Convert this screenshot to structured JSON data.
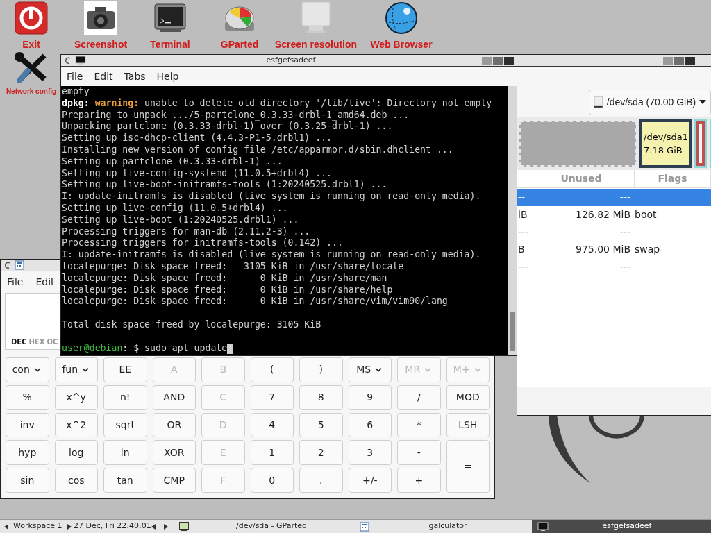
{
  "desktop_icons": [
    {
      "label": "Exit",
      "kind": "exit"
    },
    {
      "label": "Screenshot",
      "kind": "camera"
    },
    {
      "label": "Terminal",
      "kind": "terminal"
    },
    {
      "label": "GParted",
      "kind": "disk"
    },
    {
      "label": "Screen resolution",
      "kind": "monitor"
    },
    {
      "label": "Web Browser",
      "kind": "globe"
    },
    {
      "label": "Network config",
      "kind": "tools"
    }
  ],
  "gparted": {
    "device": "/dev/sda (70.00 GiB)",
    "partitions": [
      {
        "kind": "unallocated"
      },
      {
        "kind": "labeled",
        "name": "/dev/sda1",
        "size": "7.18 GiB"
      },
      {
        "kind": "swap"
      },
      {
        "kind": "cut"
      }
    ],
    "columns": [
      "Unused",
      "Flags"
    ],
    "rows": [
      {
        "column_1": "--",
        "unused": "---",
        "selected": true
      },
      {
        "column_1": "iB",
        "unused": "126.82 MiB",
        "flags": "boot",
        "selected": false
      },
      {
        "column_1": "---",
        "unused": "---",
        "selected": false
      },
      {
        "column_1": "B",
        "unused": "975.00 MiB",
        "flags": "swap",
        "selected": false
      },
      {
        "column_1": "---",
        "unused": "---",
        "selected": false
      }
    ]
  },
  "calculator": {
    "menu": [
      "File",
      "Edit"
    ],
    "bases": [
      {
        "label": "DEC",
        "selected": true
      },
      {
        "label": "HEX",
        "selected": false
      },
      {
        "label": "OC",
        "selected": false
      }
    ],
    "buttons": [
      {
        "label": "con",
        "dropdown": true,
        "disabled": false
      },
      {
        "label": "fun",
        "dropdown": true,
        "disabled": false
      },
      {
        "label": "EE",
        "dropdown": false,
        "disabled": false
      },
      {
        "label": "A",
        "dropdown": false,
        "disabled": true
      },
      {
        "label": "B",
        "dropdown": false,
        "disabled": true
      },
      {
        "label": "(",
        "dropdown": false,
        "disabled": false
      },
      {
        "label": ")",
        "dropdown": false,
        "disabled": false
      },
      {
        "label": "MS",
        "dropdown": true,
        "disabled": false
      },
      {
        "label": "MR",
        "dropdown": true,
        "disabled": true
      },
      {
        "label": "M+",
        "dropdown": true,
        "disabled": true
      },
      {
        "label": "%",
        "dropdown": false,
        "disabled": false
      },
      {
        "label": "x^y",
        "dropdown": false,
        "disabled": false
      },
      {
        "label": "n!",
        "dropdown": false,
        "disabled": false
      },
      {
        "label": "AND",
        "dropdown": false,
        "disabled": false
      },
      {
        "label": "C",
        "dropdown": false,
        "disabled": true
      },
      {
        "label": "7",
        "dropdown": false,
        "disabled": false
      },
      {
        "label": "8",
        "dropdown": false,
        "disabled": false
      },
      {
        "label": "9",
        "dropdown": false,
        "disabled": false
      },
      {
        "label": "/",
        "dropdown": false,
        "disabled": false
      },
      {
        "label": "MOD",
        "dropdown": false,
        "disabled": false
      },
      {
        "label": "inv",
        "dropdown": false,
        "disabled": false
      },
      {
        "label": "x^2",
        "dropdown": false,
        "disabled": false
      },
      {
        "label": "sqrt",
        "dropdown": false,
        "disabled": false
      },
      {
        "label": "OR",
        "dropdown": false,
        "disabled": false
      },
      {
        "label": "D",
        "dropdown": false,
        "disabled": true
      },
      {
        "label": "4",
        "dropdown": false,
        "disabled": false
      },
      {
        "label": "5",
        "dropdown": false,
        "disabled": false
      },
      {
        "label": "6",
        "dropdown": false,
        "disabled": false
      },
      {
        "label": "*",
        "dropdown": false,
        "disabled": false
      },
      {
        "label": "LSH",
        "dropdown": false,
        "disabled": false
      },
      {
        "label": "hyp",
        "dropdown": false,
        "disabled": false
      },
      {
        "label": "log",
        "dropdown": false,
        "disabled": false
      },
      {
        "label": "ln",
        "dropdown": false,
        "disabled": false
      },
      {
        "label": "XOR",
        "dropdown": false,
        "disabled": false
      },
      {
        "label": "E",
        "dropdown": false,
        "disabled": true
      },
      {
        "label": "1",
        "dropdown": false,
        "disabled": false
      },
      {
        "label": "2",
        "dropdown": false,
        "disabled": false
      },
      {
        "label": "3",
        "dropdown": false,
        "disabled": false
      },
      {
        "label": "-",
        "dropdown": false,
        "disabled": false
      },
      {
        "label": "=",
        "dropdown": false,
        "disabled": false,
        "tall": true
      },
      {
        "label": "sin",
        "dropdown": false,
        "disabled": false
      },
      {
        "label": "cos",
        "dropdown": false,
        "disabled": false
      },
      {
        "label": "tan",
        "dropdown": false,
        "disabled": false
      },
      {
        "label": "CMP",
        "dropdown": false,
        "disabled": false
      },
      {
        "label": "F",
        "dropdown": false,
        "disabled": true
      },
      {
        "label": "0",
        "dropdown": false,
        "disabled": false
      },
      {
        "label": ".",
        "dropdown": false,
        "disabled": false
      },
      {
        "label": "+/-",
        "dropdown": false,
        "disabled": false
      },
      {
        "label": "+",
        "dropdown": false,
        "disabled": false
      }
    ]
  },
  "terminal": {
    "title": "esfgefsadeef",
    "menu": [
      "File",
      "Edit",
      "Tabs",
      "Help"
    ],
    "lines": [
      {
        "text": "empty"
      },
      {
        "parts": [
          {
            "text": "dpkg:",
            "kind": "bold"
          },
          {
            "text": " warning:",
            "kind": "warning"
          },
          {
            "text": " unable to delete old directory '/lib/live': Directory not empty",
            "kind": "plain"
          }
        ]
      },
      {
        "text": "Preparing to unpack .../5-partclone_0.3.33-drbl-1_amd64.deb ..."
      },
      {
        "text": "Unpacking partclone (0.3.33-drbl-1) over (0.3.25-drbl-1) ..."
      },
      {
        "text": "Setting up isc-dhcp-client (4.4.3-P1-5.drbl1) ..."
      },
      {
        "text": "Installing new version of config file /etc/apparmor.d/sbin.dhclient ..."
      },
      {
        "text": "Setting up partclone (0.3.33-drbl-1) ..."
      },
      {
        "text": "Setting up live-config-systemd (11.0.5+drbl4) ..."
      },
      {
        "text": "Setting up live-boot-initramfs-tools (1:20240525.drbl1) ..."
      },
      {
        "text": "I: update-initramfs is disabled (live system is running on read-only media)."
      },
      {
        "text": "Setting up live-config (11.0.5+drbl4) ..."
      },
      {
        "text": "Setting up live-boot (1:20240525.drbl1) ..."
      },
      {
        "text": "Processing triggers for man-db (2.11.2-3) ..."
      },
      {
        "text": "Processing triggers for initramfs-tools (0.142) ..."
      },
      {
        "text": "I: update-initramfs is disabled (live system is running on read-only media)."
      },
      {
        "text": "localepurge: Disk space freed:   3105 KiB in /usr/share/locale"
      },
      {
        "text": "localepurge: Disk space freed:      0 KiB in /usr/share/man"
      },
      {
        "text": "localepurge: Disk space freed:      0 KiB in /usr/share/help"
      },
      {
        "text": "localepurge: Disk space freed:      0 KiB in /usr/share/vim/vim90/lang"
      },
      {
        "text": "Total disk space freed by localepurge: 3105 KiB",
        "blank_before": true
      }
    ],
    "prompt": {
      "user": "user@debian",
      "command": ": $ sudo apt update"
    }
  },
  "taskbar": {
    "workspace": "Workspace 1",
    "clock": "27 Dec, Fri 22:40:01",
    "tasks": [
      {
        "label": "/dev/sda - GParted",
        "kind": "gparted",
        "selected": false
      },
      {
        "label": "galculator",
        "kind": "calculator",
        "selected": false
      },
      {
        "label": "esfgefsadeef",
        "kind": "terminal",
        "selected": true
      }
    ]
  }
}
